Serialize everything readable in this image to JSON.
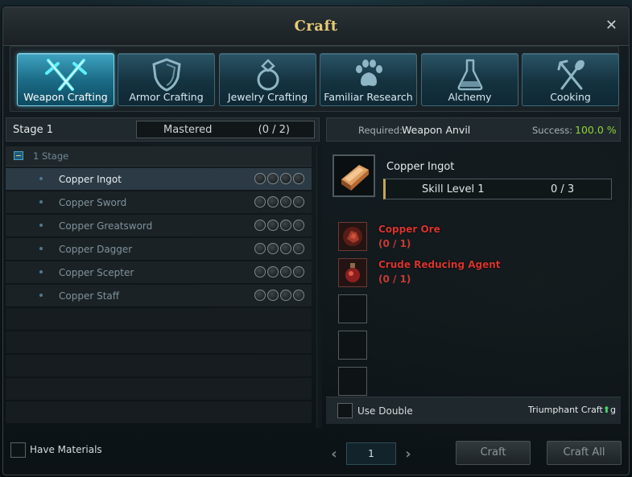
{
  "window": {
    "title": "Craft",
    "close_label": "✕"
  },
  "tabs": [
    {
      "label": "Weapon Crafting",
      "icon": "crossed-swords-icon",
      "active": true
    },
    {
      "label": "Armor Crafting",
      "icon": "shield-icon",
      "active": false
    },
    {
      "label": "Jewelry Crafting",
      "icon": "ring-icon",
      "active": false
    },
    {
      "label": "Familiar Research",
      "icon": "paw-icon",
      "active": false
    },
    {
      "label": "Alchemy",
      "icon": "flask-icon",
      "active": false
    },
    {
      "label": "Cooking",
      "icon": "fork-spoon-icon",
      "active": false
    }
  ],
  "left": {
    "stage_label": "Stage 1",
    "mastered_label": "Mastered",
    "mastered_count": "(0 / 2)",
    "group_label": "1 Stage",
    "recipes": [
      {
        "name": "Copper Ingot",
        "selected": true
      },
      {
        "name": "Copper Sword",
        "selected": false
      },
      {
        "name": "Copper Greatsword",
        "selected": false
      },
      {
        "name": "Copper Dagger",
        "selected": false
      },
      {
        "name": "Copper Scepter",
        "selected": false
      },
      {
        "name": "Copper Staff",
        "selected": false
      }
    ],
    "have_materials_label": "Have Materials"
  },
  "right": {
    "required_label": "Required:",
    "required_value": "Weapon Anvil",
    "success_label": "Success:",
    "success_value": "100.0 %",
    "result_name": "Copper Ingot",
    "skill_label": "Skill Level 1",
    "skill_count": "0 / 3",
    "materials": [
      {
        "name": "Copper Ore",
        "count": "(0 / 1)",
        "icon": "copper-ore-icon"
      },
      {
        "name": "Crude Reducing Agent",
        "count": "(0 / 1)",
        "icon": "potion-flask-icon"
      }
    ],
    "use_double_label": "Use Double",
    "triumphant_prefix": "Triumphant Craft",
    "triumphant_arrow": "⬆",
    "triumphant_suffix": "g"
  },
  "footer": {
    "page_number": "1",
    "craft_label": "Craft",
    "craft_all_label": "Craft All"
  },
  "colors": {
    "title_gold": "#e8c977",
    "success_green": "#8fd43a",
    "missing_red": "#d8342e",
    "tab_active_cyan": "#7fd4ea"
  }
}
